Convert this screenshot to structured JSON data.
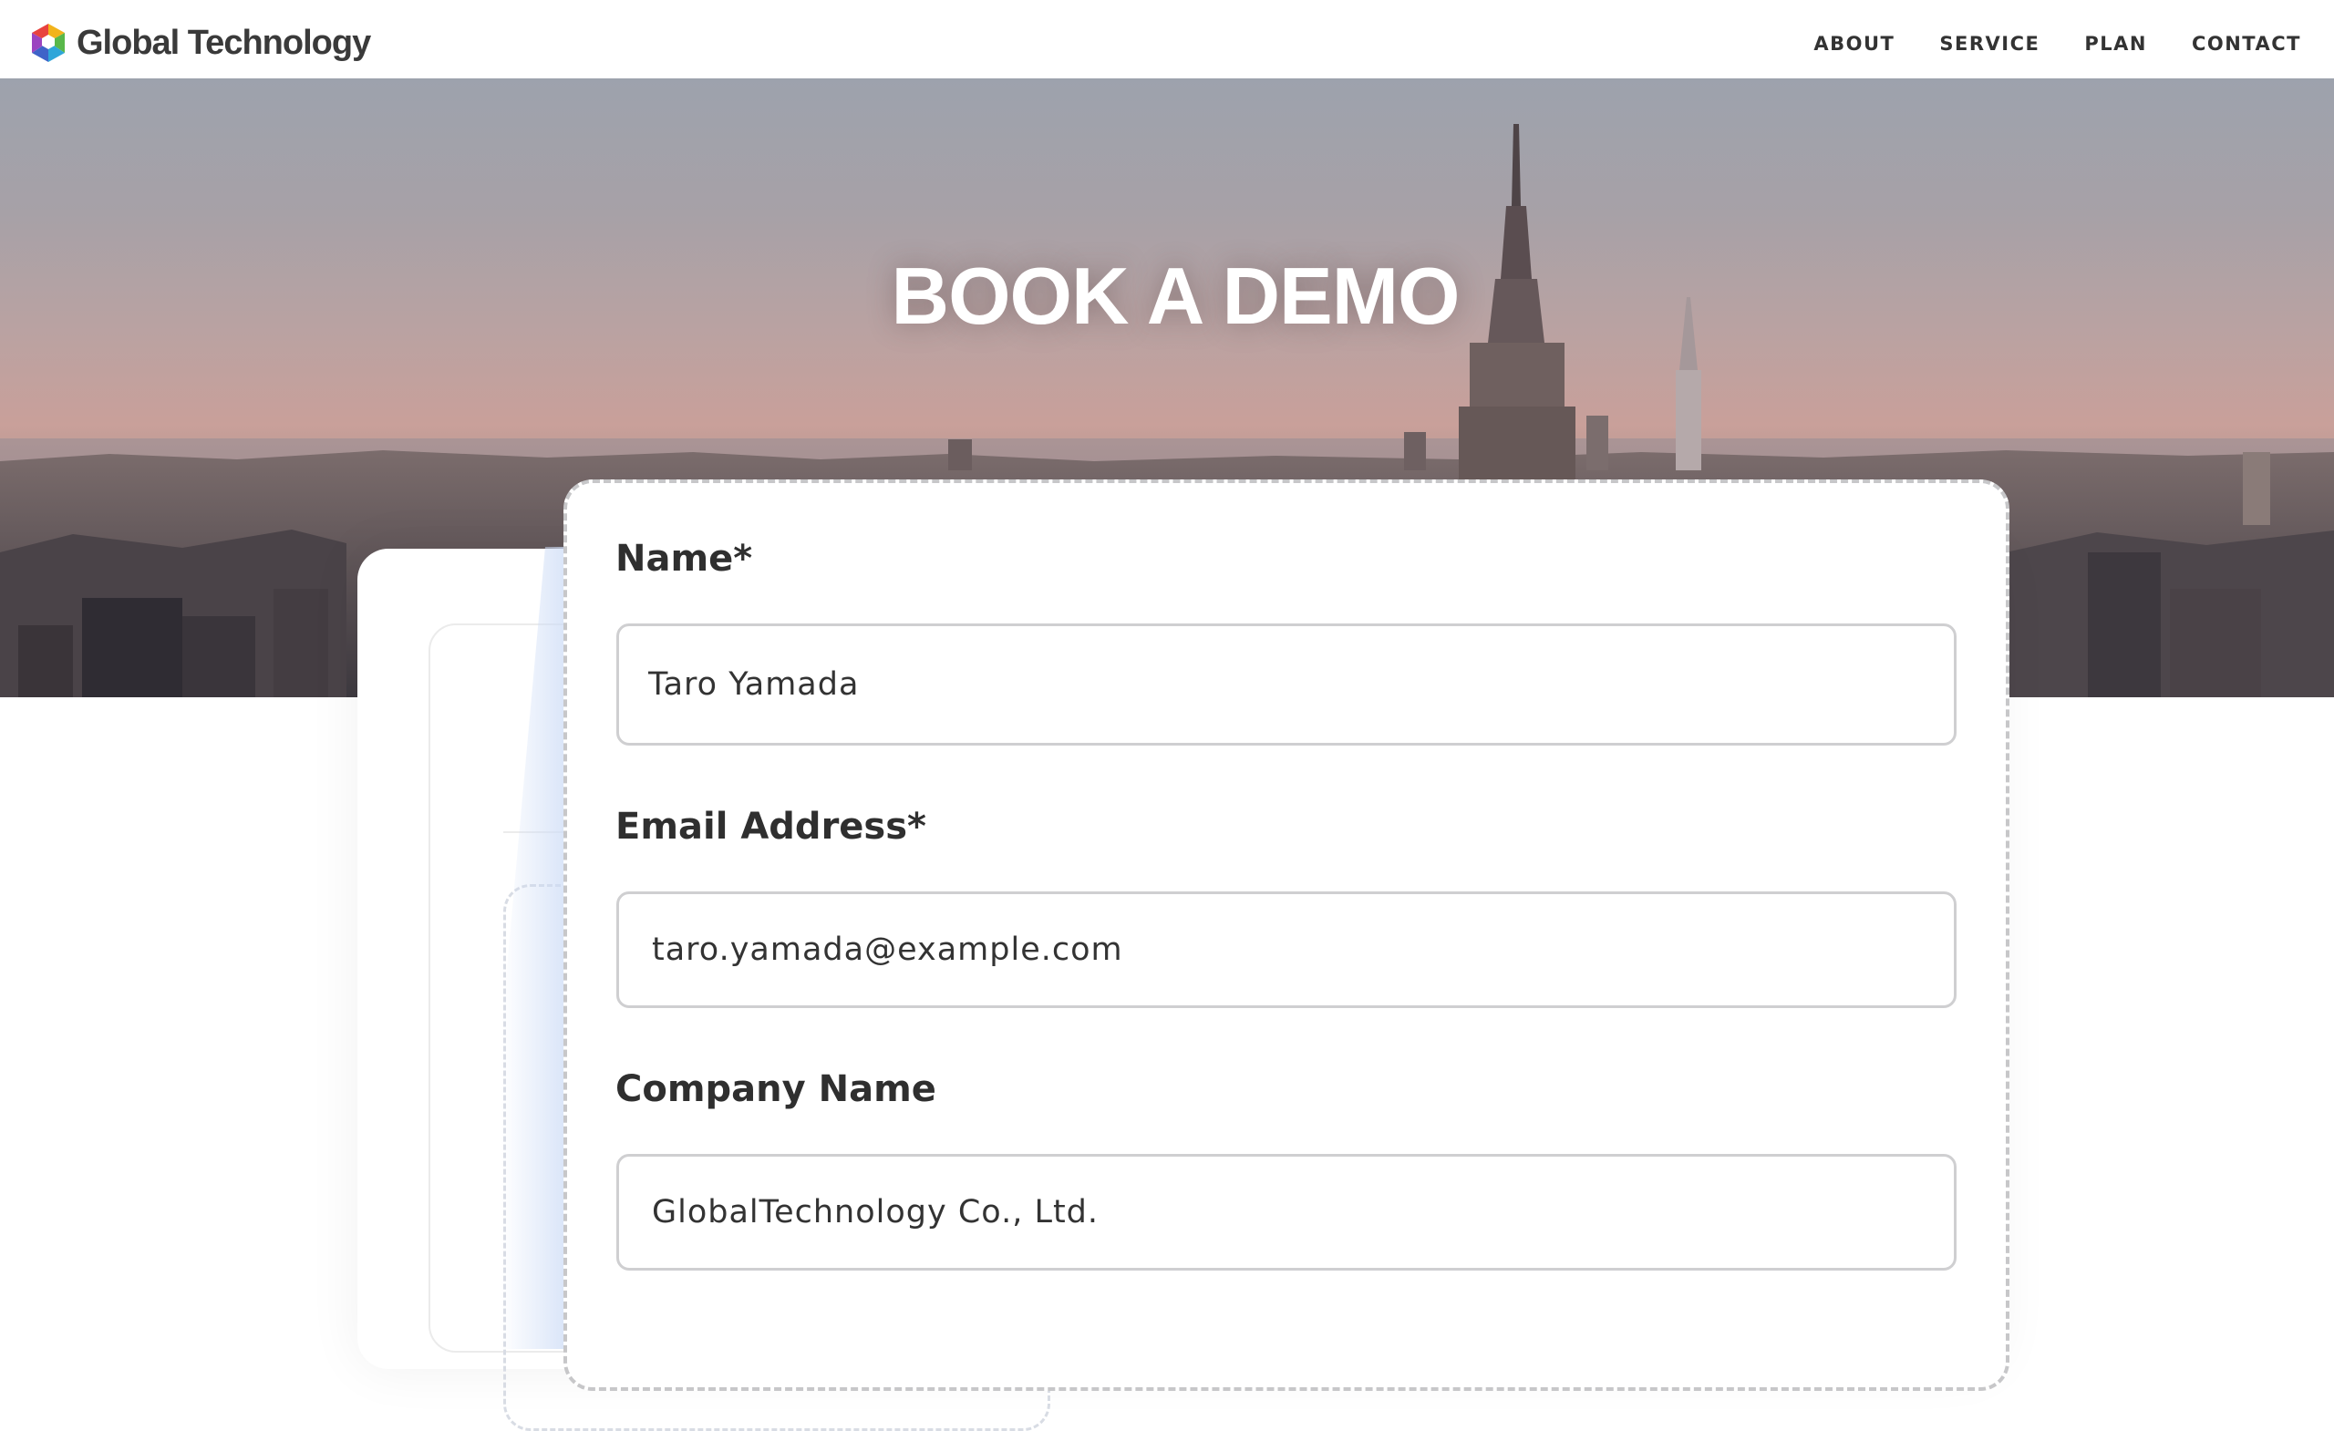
{
  "header": {
    "logo_text": "Global Technology",
    "nav": [
      "ABOUT",
      "SERVICE",
      "PLAN",
      "CONTACT"
    ]
  },
  "hero": {
    "title": "BOOK A DEMO"
  },
  "form": {
    "name_label": "Name*",
    "name_value": "Taro Yamada",
    "email_label": "Email Address*",
    "email_value": "taro.yamada@example.com",
    "company_label": "Company Name",
    "company_value": "GlobalTechnology Co., Ltd."
  },
  "colors": {
    "text_dark": "#2f2f2f",
    "input_border": "#cfcfd1",
    "card_dash": "#c7c7c9"
  },
  "icons": [
    "logo-hexagon-icon"
  ]
}
